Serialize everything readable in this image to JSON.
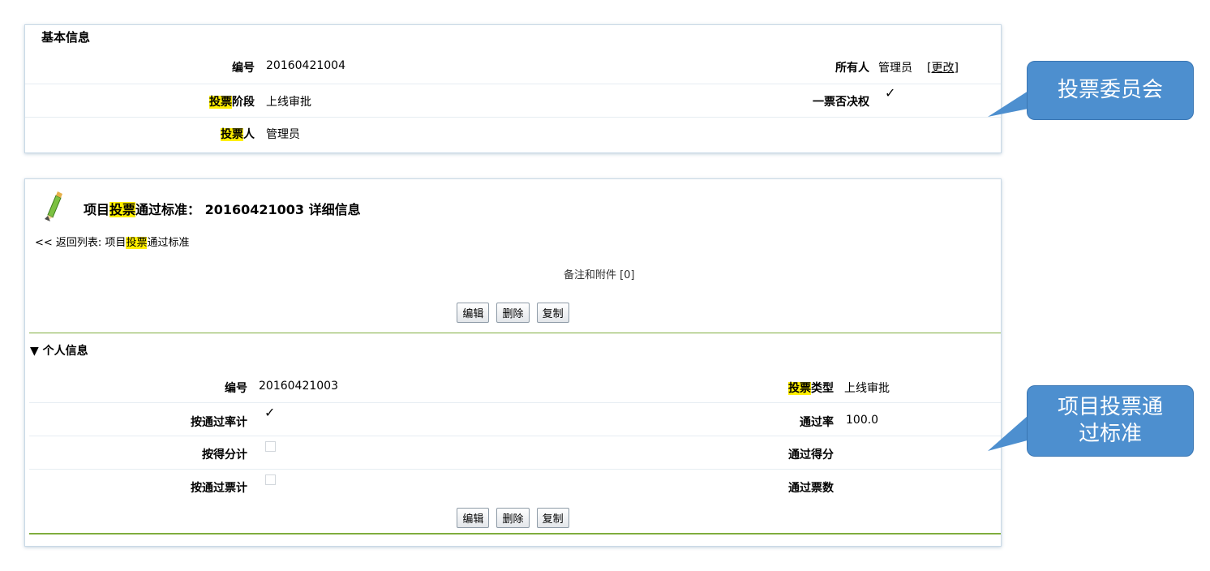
{
  "panel1": {
    "title": "基本信息",
    "rows": [
      {
        "left_label": "编号",
        "left_value": "20160421004",
        "right_label": "所有人",
        "right_value": "管理员",
        "right_link": "[更改]"
      },
      {
        "left_label_hl": "投票",
        "left_label_rest": "阶段",
        "left_value": "上线审批",
        "right_label": "一票否决权",
        "right_checked": true
      },
      {
        "left_label_hl": "投票",
        "left_label_rest": "人",
        "left_value": "管理员"
      }
    ]
  },
  "panel2": {
    "title_pre": "项目",
    "title_hl": "投票",
    "title_post": "通过标准： 20160421003 详细信息",
    "back_pre": "<< 返回列表: 项目",
    "back_hl": "投票",
    "back_post": "通过标准",
    "notes": "备注和附件 [0]",
    "buttons": [
      "编辑",
      "删除",
      "复制"
    ],
    "section": "▼ 个人信息",
    "rows": [
      {
        "left_label": "编号",
        "left_value": "20160421003",
        "right_label_hl": "投票",
        "right_label_rest": "类型",
        "right_value": "上线审批"
      },
      {
        "left_label": "按通过率计",
        "left_checked": true,
        "right_label": "通过率",
        "right_value": "100.0"
      },
      {
        "left_label": "按得分计",
        "left_checked": false,
        "right_label": "通过得分",
        "right_value": ""
      },
      {
        "left_label": "按通过票计",
        "left_checked": false,
        "right_label": "通过票数",
        "right_value": ""
      }
    ]
  },
  "callouts": {
    "first": "投票委员会",
    "second_line1": "项目投票通",
    "second_line2": "过标准"
  },
  "colors": {
    "highlight": "#ffef00",
    "callout": "#4d8fcf",
    "section_rule": "#7fad3e"
  }
}
